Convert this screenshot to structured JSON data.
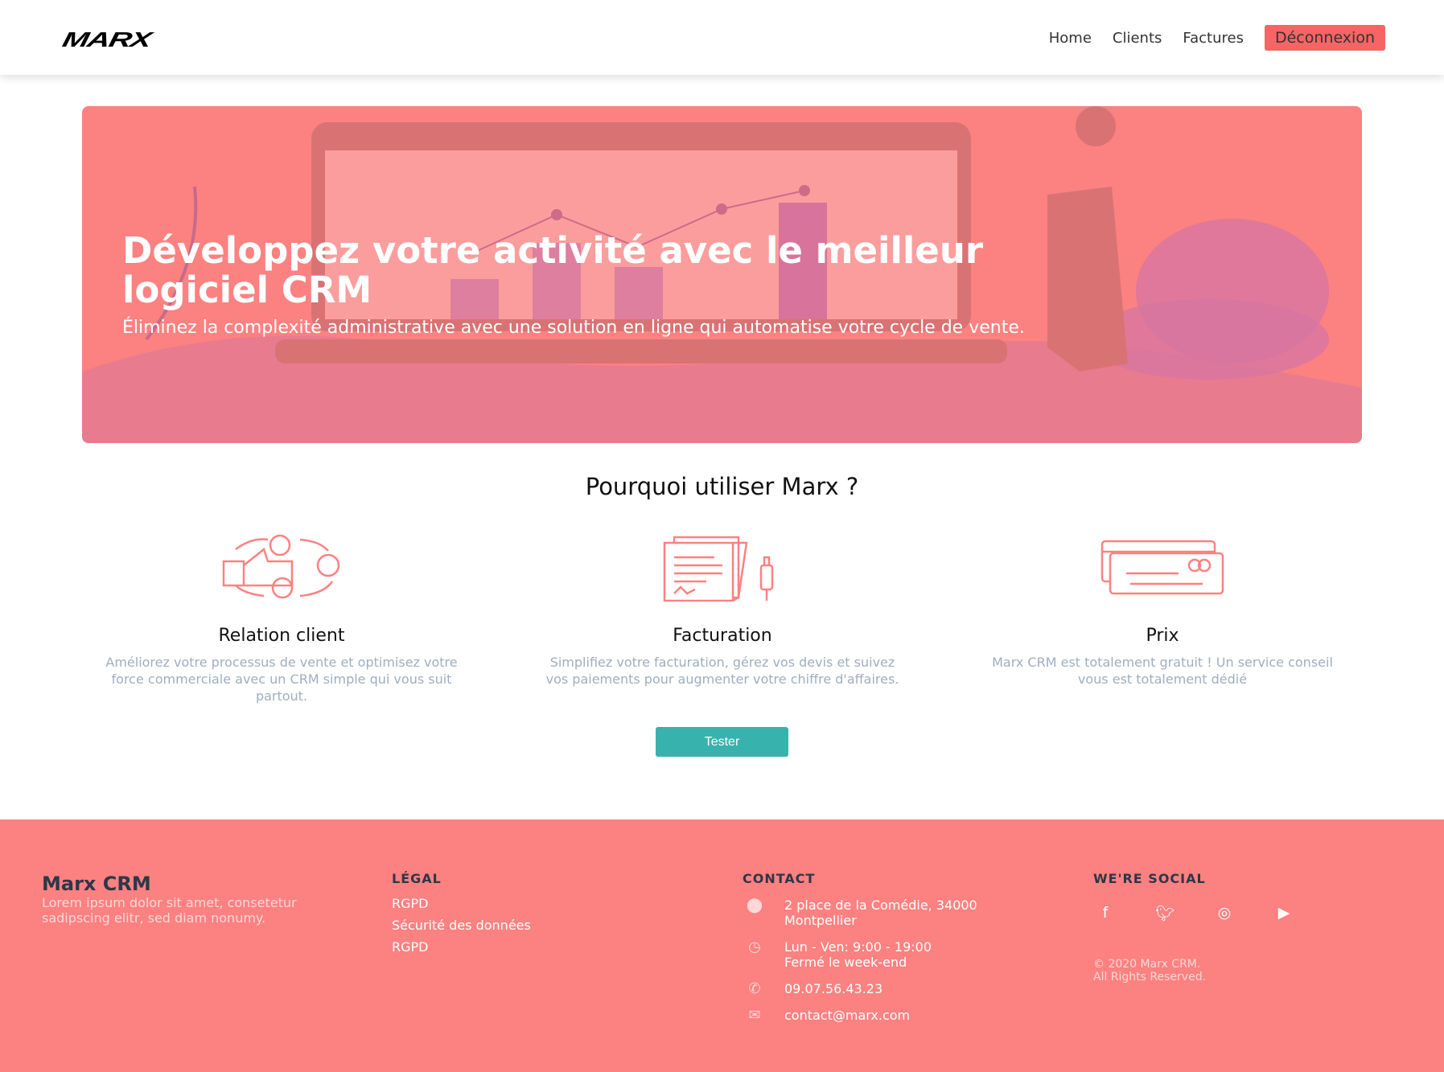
{
  "nav": {
    "logo": "MARX",
    "links": [
      "Home",
      "Clients",
      "Factures"
    ],
    "logout": "Déconnexion"
  },
  "hero": {
    "title": "Développez votre activité avec le meilleur logiciel CRM",
    "subtitle": "Éliminez la complexité administrative avec une solution en ligne qui automatise votre cycle de vente."
  },
  "why": {
    "title": "Pourquoi utiliser Marx ?",
    "features": [
      {
        "title": "Relation client",
        "text": "Améliorez votre processus de vente et optimisez votre force commerciale avec un CRM simple qui vous suit partout."
      },
      {
        "title": "Facturation",
        "text": "Simplifiez votre facturation, gérez vos devis et suivez vos paiements pour augmenter votre chiffre d'affaires."
      },
      {
        "title": "Prix",
        "text": "Marx CRM est totalement gratuit ! Un service conseil vous est totalement dédié"
      }
    ],
    "button": "Tester"
  },
  "footer": {
    "brand": "Marx CRM",
    "lorem": "Lorem ipsum dolor sit amet, consetetur sadipscing elitr, sed diam nonumy.",
    "legal": {
      "title": "LÉGAL",
      "links": [
        "RGPD",
        "Sécurité des données",
        "RGPD"
      ]
    },
    "contact": {
      "title": "CONTACT",
      "address": "2 place de la Comédie, 34000 Montpellier",
      "hours1": "Lun - Ven: 9:00 - 19:00",
      "hours2": "Fermé le week-end",
      "phone": "09.07.56.43.23",
      "email": "contact@marx.com"
    },
    "social": {
      "title": "WE'RE SOCIAL",
      "copy1": "© 2020 Marx CRM.",
      "copy2": "All Rights Reserved."
    }
  },
  "colors": {
    "accent": "#fc8181",
    "button": "#f56565",
    "teal": "#38b2ac"
  }
}
